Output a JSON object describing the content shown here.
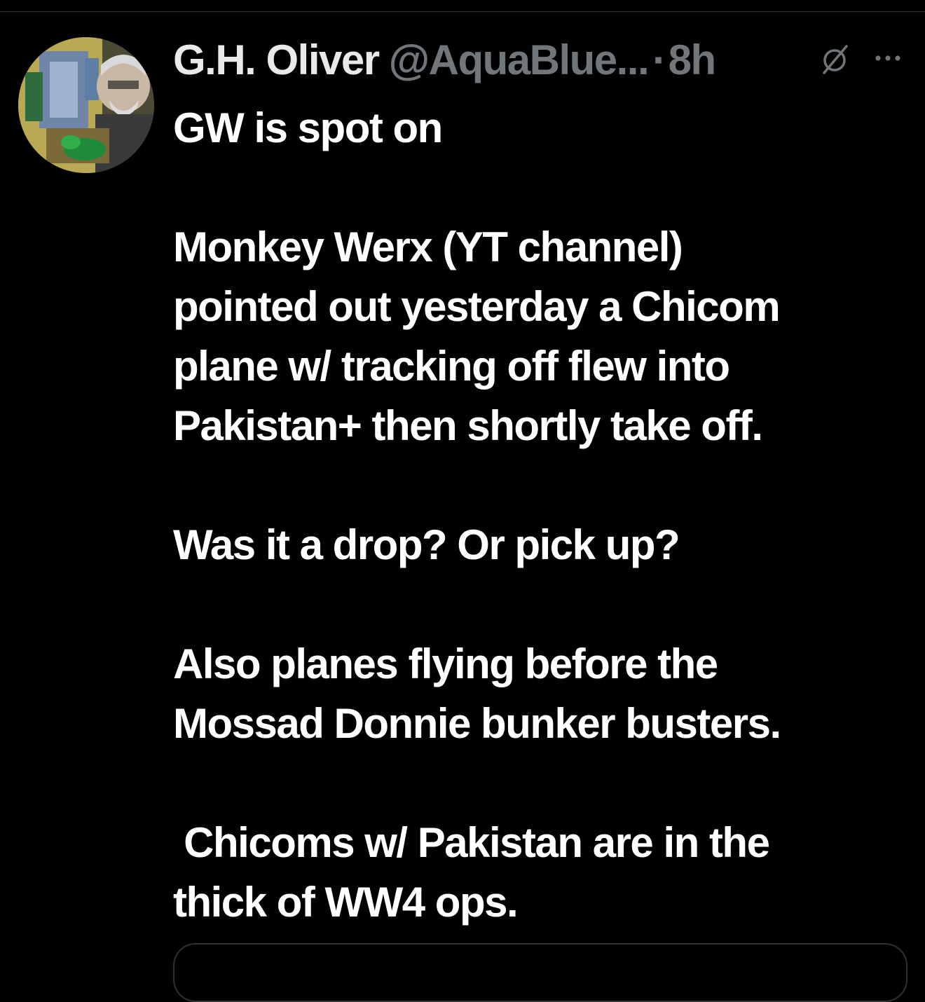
{
  "tweet": {
    "display_name": "G.H. Oliver",
    "handle": "@AquaBlue...",
    "separator": "·",
    "time": "8h",
    "text": "GW is spot on\n\nMonkey Werx (YT channel)\npointed out yesterday a Chicom\nplane w/ tracking off flew into\nPakistan+ then shortly take off.\n\nWas it a drop? Or pick up?\n\nAlso planes flying before the\nMossad Donnie bunker busters.\n\n Chicoms w/ Pakistan are in the\nthick of WW4 ops."
  },
  "icons": {
    "avatar": "profile-photo",
    "grok": "grok-icon",
    "more": "more-options-icon"
  },
  "colors": {
    "background": "#000000",
    "text": "#ffffff",
    "secondary_text": "#71767b",
    "divider": "#2f3336"
  }
}
